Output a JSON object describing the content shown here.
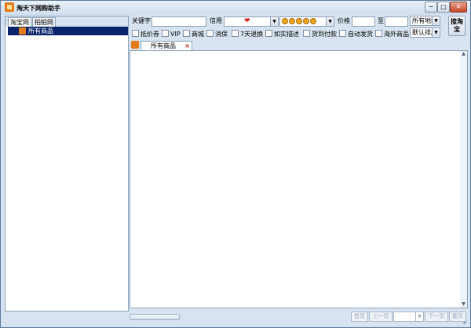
{
  "window": {
    "title": "淘天下网购助手",
    "controls": {
      "minimize": "−",
      "maximize": "□",
      "close": "✕"
    }
  },
  "left_panel": {
    "tabs": [
      "淘宝网",
      "拍拍网"
    ],
    "active_tab": 0,
    "tree": [
      {
        "label": "所有商品",
        "selected": true
      }
    ]
  },
  "search": {
    "keyword_label": "关键字",
    "keyword_value": "",
    "credit_label": "信用",
    "credit_symbol": "❤",
    "credit_high_icon": "crown-icon",
    "price_label": "价格",
    "price_to_label": "至",
    "price_min": "",
    "price_max": "",
    "region": "所有地区",
    "sort": "默认排序",
    "search_button": "搜淘宝",
    "filters": [
      "抵价券",
      "VIP",
      "商城",
      "消保",
      "7天退换",
      "如实描述",
      "货到付款",
      "自动发货",
      "海外商品"
    ]
  },
  "results": {
    "tabs": [
      {
        "label": "所有商品",
        "close": "×"
      }
    ]
  },
  "pager": {
    "first": "首页",
    "prev": "上一页",
    "next": "下一页",
    "last": "尾页"
  },
  "colors": {
    "selection": "#0a246a",
    "accent_orange": "#e57a16",
    "heart_red": "#d9261c"
  }
}
